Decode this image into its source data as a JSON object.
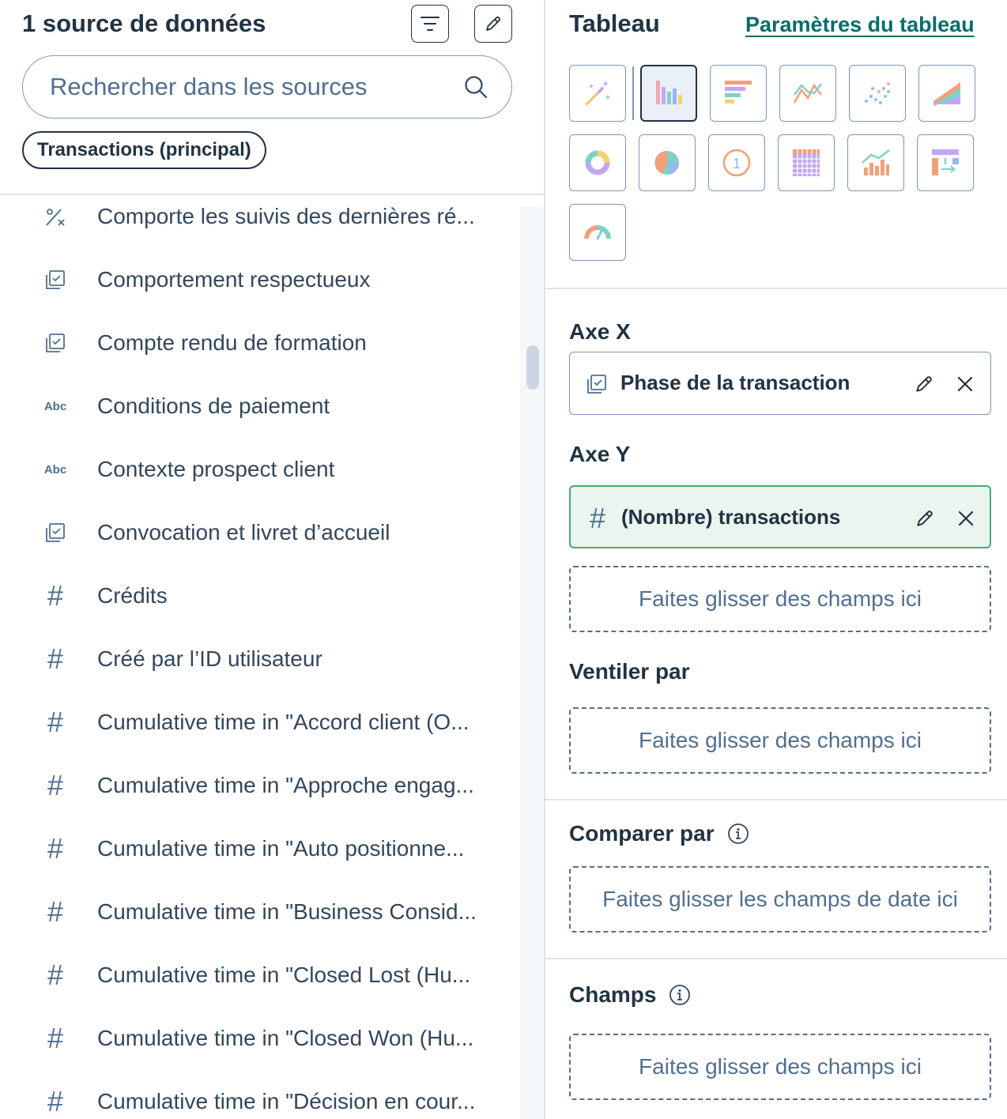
{
  "data_panel": {
    "title": "1 source de données",
    "search_placeholder": "Rechercher dans les sources",
    "source_tag": "Transactions (principal)",
    "fields": [
      {
        "icon": "percent-icon",
        "label": "Comporte les suivis des dernières ré..."
      },
      {
        "icon": "checkbox-icon",
        "label": "Comportement respectueux"
      },
      {
        "icon": "checkbox-icon",
        "label": "Compte rendu de formation"
      },
      {
        "icon": "text-icon",
        "label": "Conditions de paiement"
      },
      {
        "icon": "text-icon",
        "label": "Contexte prospect client"
      },
      {
        "icon": "checkbox-icon",
        "label": "Convocation et livret d’accueil"
      },
      {
        "icon": "number-icon",
        "label": "Crédits"
      },
      {
        "icon": "number-icon",
        "label": "Créé par l’ID utilisateur"
      },
      {
        "icon": "number-icon",
        "label": "Cumulative time in \"Accord client (O..."
      },
      {
        "icon": "number-icon",
        "label": "Cumulative time in \"Approche engag..."
      },
      {
        "icon": "number-icon",
        "label": "Cumulative time in \"Auto positionne..."
      },
      {
        "icon": "number-icon",
        "label": "Cumulative time in \"Business Consid..."
      },
      {
        "icon": "number-icon",
        "label": "Cumulative time in \"Closed Lost (Hu..."
      },
      {
        "icon": "number-icon",
        "label": "Cumulative time in \"Closed Won (Hu..."
      },
      {
        "icon": "number-icon",
        "label": "Cumulative time in \"Décision en cour..."
      }
    ],
    "abc_label": "Abc",
    "hash_label": "#"
  },
  "config_panel": {
    "title": "Tableau",
    "settings_link": "Paramètres du tableau",
    "chart_types": [
      {
        "name": "magic-wand-icon",
        "active": false
      },
      {
        "name": "vertical-bar-chart-icon",
        "active": true
      },
      {
        "name": "horizontal-bar-chart-icon",
        "active": false
      },
      {
        "name": "line-chart-icon",
        "active": false
      },
      {
        "name": "scatter-chart-icon",
        "active": false
      },
      {
        "name": "area-chart-icon",
        "active": false
      },
      {
        "name": "donut-chart-icon",
        "active": false
      },
      {
        "name": "pie-chart-icon",
        "active": false
      },
      {
        "name": "kpi-number-icon",
        "active": false
      },
      {
        "name": "pivot-table-icon",
        "active": false
      },
      {
        "name": "combo-chart-icon",
        "active": false
      },
      {
        "name": "sankey-chart-icon",
        "active": false
      },
      {
        "name": "gauge-chart-icon",
        "active": false
      }
    ],
    "kpi_digit": "1",
    "x_axis": {
      "label": "Axe X",
      "field": "Phase de la transaction"
    },
    "y_axis": {
      "label": "Axe Y",
      "field": "(Nombre) transactions",
      "drop_text": "Faites glisser des champs ici"
    },
    "breakdown": {
      "label": "Ventiler par",
      "drop_text": "Faites glisser des champs ici"
    },
    "compare": {
      "label": "Comparer par",
      "drop_text": "Faites glisser les champs de date ici"
    },
    "fields_section": {
      "label": "Champs",
      "drop_text": "Faites glisser des champs ici"
    }
  },
  "colors": {
    "text_dark": "#213343",
    "text_muted": "#516f90",
    "link_teal": "#0b6b6b",
    "y_axis_bg": "#ebf5f0",
    "y_axis_border": "#4aa971"
  }
}
